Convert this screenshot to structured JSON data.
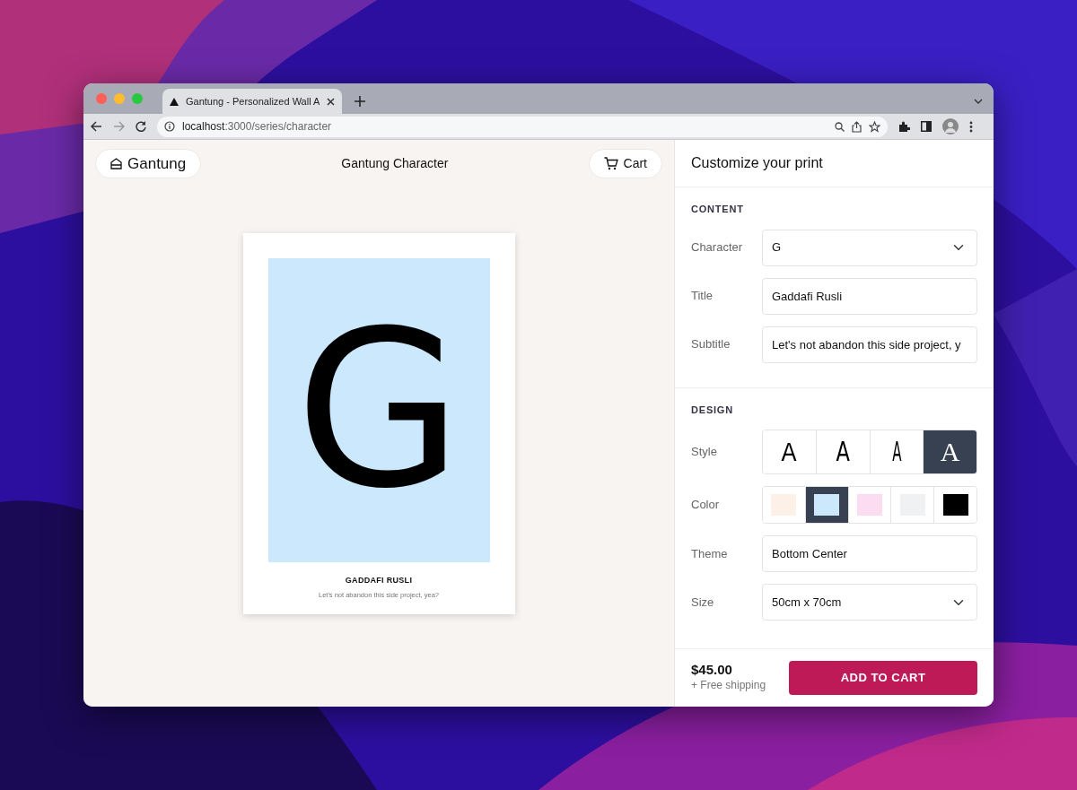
{
  "browser": {
    "tab_title": "Gantung - Personalized Wall A",
    "url_host": "localhost",
    "url_path": ":3000/series/character"
  },
  "header": {
    "logo": "Gantung",
    "title": "Gantung Character",
    "cart": "Cart"
  },
  "poster": {
    "character": "G",
    "title": "GADDAFI RUSLI",
    "subtitle": "Let's not abandon this side project, yea?"
  },
  "panel": {
    "title": "Customize your print",
    "content": {
      "heading": "CONTENT",
      "fields": [
        {
          "label": "Character",
          "kind": "select",
          "value": "G"
        },
        {
          "label": "Title",
          "kind": "text",
          "value": "Gaddafi Rusli"
        },
        {
          "label": "Subtitle",
          "kind": "text",
          "value": "Let's not abandon this side project, y"
        }
      ]
    },
    "design": {
      "heading": "DESIGN",
      "style": {
        "label": "Style",
        "options": [
          {
            "text": "A",
            "kind": "sans",
            "selected": false
          },
          {
            "text": "A",
            "kind": "narrow",
            "selected": false
          },
          {
            "text": "A",
            "kind": "condensed",
            "selected": false
          },
          {
            "text": "A",
            "kind": "serif",
            "selected": true
          }
        ]
      },
      "color": {
        "label": "Color",
        "options": [
          {
            "color": "#fdf0e6",
            "selected": false
          },
          {
            "color": "#cce8fc",
            "selected": true
          },
          {
            "color": "#fcdcf0",
            "selected": false
          },
          {
            "color": "#f0f1f3",
            "selected": false
          },
          {
            "color": "#000000",
            "selected": false
          }
        ]
      },
      "fields": [
        {
          "label": "Theme",
          "kind": "text",
          "value": "Bottom Center"
        },
        {
          "label": "Size",
          "kind": "select",
          "value": "50cm x 70cm"
        }
      ]
    },
    "footer": {
      "price": "$45.00",
      "shipping": "+ Free shipping",
      "button": "ADD TO CART"
    }
  }
}
